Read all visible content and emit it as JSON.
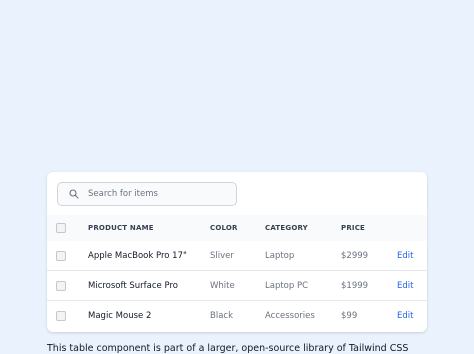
{
  "search": {
    "placeholder": "Search for items"
  },
  "table": {
    "headers": [
      "PRODUCT NAME",
      "COLOR",
      "CATEGORY",
      "PRICE"
    ],
    "rows": [
      {
        "name": "Apple MacBook Pro 17\"",
        "color": "Sliver",
        "category": "Laptop",
        "price": "$2999",
        "action": "Edit"
      },
      {
        "name": "Microsoft Surface Pro",
        "color": "White",
        "category": "Laptop PC",
        "price": "$1999",
        "action": "Edit"
      },
      {
        "name": "Magic Mouse 2",
        "color": "Black",
        "category": "Accessories",
        "price": "$99",
        "action": "Edit"
      }
    ]
  },
  "caption": "This table component is part of a larger, open-source library of Tailwind CSS",
  "colors": {
    "background": "#eaf2fd",
    "link": "#2563eb",
    "header_bg": "#f9fafb"
  },
  "icons": {
    "search": "search-icon"
  }
}
